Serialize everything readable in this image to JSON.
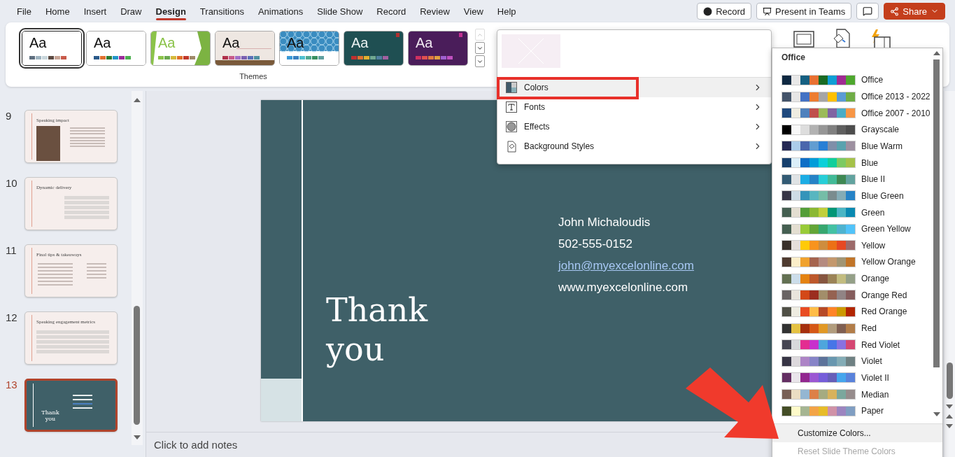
{
  "ribbon_tabs": [
    {
      "label": "File",
      "selected": false
    },
    {
      "label": "Home",
      "selected": false
    },
    {
      "label": "Insert",
      "selected": false
    },
    {
      "label": "Draw",
      "selected": false
    },
    {
      "label": "Design",
      "selected": true
    },
    {
      "label": "Transitions",
      "selected": false
    },
    {
      "label": "Animations",
      "selected": false
    },
    {
      "label": "Slide Show",
      "selected": false
    },
    {
      "label": "Record",
      "selected": false
    },
    {
      "label": "Review",
      "selected": false
    },
    {
      "label": "View",
      "selected": false
    },
    {
      "label": "Help",
      "selected": false
    }
  ],
  "title_actions": {
    "record": "Record",
    "present": "Present in Teams",
    "share": "Share"
  },
  "themes": {
    "label": "Themes",
    "items": [
      {
        "kind": "plain",
        "sample": "Aa",
        "selected": true,
        "colors": [
          {
            "color": "#5f6f7f"
          },
          {
            "color": "#9fb4c0"
          },
          {
            "color": "#c9d7dc"
          },
          {
            "color": "#5b4a42"
          },
          {
            "color": "#c7a496"
          },
          {
            "color": "#c85a4a"
          }
        ]
      },
      {
        "kind": "plain",
        "sample": "Aa",
        "selected": false,
        "colors": [
          {
            "color": "#2a5a8a"
          },
          {
            "color": "#e07030"
          },
          {
            "color": "#2e7d32"
          },
          {
            "color": "#2196c8"
          },
          {
            "color": "#9c2c9a"
          },
          {
            "color": "#4caf50"
          }
        ]
      },
      {
        "kind": "facet",
        "sample": "Aa",
        "selected": false,
        "colors": [
          {
            "color": "#8bc34a"
          },
          {
            "color": "#6aa84f"
          },
          {
            "color": "#d4b93c"
          },
          {
            "color": "#e0702a"
          },
          {
            "color": "#c0392b"
          },
          {
            "color": "#a08a6a"
          }
        ]
      },
      {
        "kind": "paper",
        "sample": "Aa",
        "selected": false,
        "colors": [
          {
            "color": "#b0304a"
          },
          {
            "color": "#c85a8a"
          },
          {
            "color": "#a070c8"
          },
          {
            "color": "#7a60b0"
          },
          {
            "color": "#5a70b8"
          },
          {
            "color": "#5090a0"
          }
        ]
      },
      {
        "kind": "pattern",
        "sample": "Aa",
        "selected": false,
        "colors": [
          {
            "color": "#3a9ad8"
          },
          {
            "color": "#3a80c0"
          },
          {
            "color": "#50c0d0"
          },
          {
            "color": "#50a890"
          },
          {
            "color": "#3a9060"
          },
          {
            "color": "#60a0a0"
          }
        ]
      },
      {
        "kind": "teal",
        "sample": "Aa",
        "selected": false,
        "colors": [
          {
            "color": "#c03030"
          },
          {
            "color": "#e07030"
          },
          {
            "color": "#e0b030"
          },
          {
            "color": "#70a890"
          },
          {
            "color": "#5080a0"
          },
          {
            "color": "#a060a0"
          }
        ]
      },
      {
        "kind": "purple",
        "sample": "Aa",
        "selected": false,
        "colors": [
          {
            "color": "#d03060"
          },
          {
            "color": "#e05050"
          },
          {
            "color": "#e07a40"
          },
          {
            "color": "#e0a040"
          },
          {
            "color": "#a060d0"
          },
          {
            "color": "#c050c0"
          }
        ]
      }
    ]
  },
  "variants_menu": {
    "items": [
      {
        "kind": "colors",
        "label": "Colors",
        "selected": true
      },
      {
        "kind": "fonts",
        "label": "Fonts",
        "selected": false
      },
      {
        "kind": "effects",
        "label": "Effects",
        "selected": false
      },
      {
        "kind": "background",
        "label": "Background Styles",
        "selected": false
      }
    ]
  },
  "colors_menu": {
    "heading": "Office",
    "palettes": [
      {
        "name": "Office",
        "colors": [
          {
            "color": "#0e2841"
          },
          {
            "color": "#e8e8e8"
          },
          {
            "color": "#156082"
          },
          {
            "color": "#e97132"
          },
          {
            "color": "#196b24"
          },
          {
            "color": "#0f9ed5"
          },
          {
            "color": "#a02b93"
          },
          {
            "color": "#4ea72e"
          }
        ]
      },
      {
        "name": "Office 2013 - 2022",
        "colors": [
          {
            "color": "#44546a"
          },
          {
            "color": "#e7e6e6"
          },
          {
            "color": "#4472c4"
          },
          {
            "color": "#ed7d31"
          },
          {
            "color": "#a5a5a5"
          },
          {
            "color": "#ffc000"
          },
          {
            "color": "#5b9bd5"
          },
          {
            "color": "#70ad47"
          }
        ]
      },
      {
        "name": "Office 2007 - 2010",
        "colors": [
          {
            "color": "#1f497d"
          },
          {
            "color": "#eeece1"
          },
          {
            "color": "#4f81bd"
          },
          {
            "color": "#c0504d"
          },
          {
            "color": "#9bbb59"
          },
          {
            "color": "#8064a2"
          },
          {
            "color": "#4bacc6"
          },
          {
            "color": "#f79646"
          }
        ]
      },
      {
        "name": "Grayscale",
        "colors": [
          {
            "color": "#000000"
          },
          {
            "color": "#f8f8f8"
          },
          {
            "color": "#dddddd"
          },
          {
            "color": "#b2b2b2"
          },
          {
            "color": "#969696"
          },
          {
            "color": "#808080"
          },
          {
            "color": "#5f5f5f"
          },
          {
            "color": "#4d4d4d"
          }
        ]
      },
      {
        "name": "Blue Warm",
        "colors": [
          {
            "color": "#242852"
          },
          {
            "color": "#acccea"
          },
          {
            "color": "#4a66ac"
          },
          {
            "color": "#629dd1"
          },
          {
            "color": "#297fd5"
          },
          {
            "color": "#7f8fa9"
          },
          {
            "color": "#5aa2ae"
          },
          {
            "color": "#9d90a0"
          }
        ]
      },
      {
        "name": "Blue",
        "colors": [
          {
            "color": "#17406d"
          },
          {
            "color": "#dbeff9"
          },
          {
            "color": "#0f6fc6"
          },
          {
            "color": "#009dd9"
          },
          {
            "color": "#0bd0d9"
          },
          {
            "color": "#10cf9b"
          },
          {
            "color": "#7cca62"
          },
          {
            "color": "#a5c249"
          }
        ]
      },
      {
        "name": "Blue II",
        "colors": [
          {
            "color": "#335b74"
          },
          {
            "color": "#dfe3e5"
          },
          {
            "color": "#1cade4"
          },
          {
            "color": "#2683c6"
          },
          {
            "color": "#27ced7"
          },
          {
            "color": "#42ba97"
          },
          {
            "color": "#3e8853"
          },
          {
            "color": "#62a39f"
          }
        ]
      },
      {
        "name": "Blue Green",
        "colors": [
          {
            "color": "#373545"
          },
          {
            "color": "#cedbe6"
          },
          {
            "color": "#3494ba"
          },
          {
            "color": "#58b6c0"
          },
          {
            "color": "#75bda7"
          },
          {
            "color": "#7a8c8e"
          },
          {
            "color": "#84acb6"
          },
          {
            "color": "#2683c6"
          }
        ]
      },
      {
        "name": "Green",
        "colors": [
          {
            "color": "#455f51"
          },
          {
            "color": "#e3ded1"
          },
          {
            "color": "#549e39"
          },
          {
            "color": "#8ab833"
          },
          {
            "color": "#c0cf3a"
          },
          {
            "color": "#029676"
          },
          {
            "color": "#4ab5c4"
          },
          {
            "color": "#0989b1"
          }
        ]
      },
      {
        "name": "Green Yellow",
        "colors": [
          {
            "color": "#455f51"
          },
          {
            "color": "#e3ded1"
          },
          {
            "color": "#99cb38"
          },
          {
            "color": "#63a537"
          },
          {
            "color": "#37a76f"
          },
          {
            "color": "#44c1a3"
          },
          {
            "color": "#4eb3cf"
          },
          {
            "color": "#51c3f9"
          }
        ]
      },
      {
        "name": "Yellow",
        "colors": [
          {
            "color": "#39302a"
          },
          {
            "color": "#e5dedb"
          },
          {
            "color": "#ffca08"
          },
          {
            "color": "#f8931d"
          },
          {
            "color": "#ce8d3e"
          },
          {
            "color": "#ec7016"
          },
          {
            "color": "#e64823"
          },
          {
            "color": "#9c6a6a"
          }
        ]
      },
      {
        "name": "Yellow Orange",
        "colors": [
          {
            "color": "#4e3b30"
          },
          {
            "color": "#fbeec9"
          },
          {
            "color": "#f0a22e"
          },
          {
            "color": "#a5644e"
          },
          {
            "color": "#b58b80"
          },
          {
            "color": "#c3986d"
          },
          {
            "color": "#a19574"
          },
          {
            "color": "#c17529"
          }
        ]
      },
      {
        "name": "Orange",
        "colors": [
          {
            "color": "#637052"
          },
          {
            "color": "#ccddea"
          },
          {
            "color": "#e48312"
          },
          {
            "color": "#bd582c"
          },
          {
            "color": "#865640"
          },
          {
            "color": "#9b8357"
          },
          {
            "color": "#c2bc80"
          },
          {
            "color": "#94a088"
          }
        ]
      },
      {
        "name": "Orange Red",
        "colors": [
          {
            "color": "#696464"
          },
          {
            "color": "#e9e5dc"
          },
          {
            "color": "#d34817"
          },
          {
            "color": "#9b2d1f"
          },
          {
            "color": "#a28e6a"
          },
          {
            "color": "#956251"
          },
          {
            "color": "#918485"
          },
          {
            "color": "#855d5d"
          }
        ]
      },
      {
        "name": "Red Orange",
        "colors": [
          {
            "color": "#505046"
          },
          {
            "color": "#eeece1"
          },
          {
            "color": "#e84c22"
          },
          {
            "color": "#ffbd47"
          },
          {
            "color": "#b64926"
          },
          {
            "color": "#ff8427"
          },
          {
            "color": "#cc9900"
          },
          {
            "color": "#b22600"
          }
        ]
      },
      {
        "name": "Red",
        "colors": [
          {
            "color": "#323232"
          },
          {
            "color": "#e5c243"
          },
          {
            "color": "#a5300f"
          },
          {
            "color": "#d55816"
          },
          {
            "color": "#e19825"
          },
          {
            "color": "#b19c7d"
          },
          {
            "color": "#7f5f52"
          },
          {
            "color": "#b27d49"
          }
        ]
      },
      {
        "name": "Red Violet",
        "colors": [
          {
            "color": "#454551"
          },
          {
            "color": "#d8d9dc"
          },
          {
            "color": "#e32d91"
          },
          {
            "color": "#c830cc"
          },
          {
            "color": "#4ea6dc"
          },
          {
            "color": "#4775e7"
          },
          {
            "color": "#8971e1"
          },
          {
            "color": "#d54773"
          }
        ]
      },
      {
        "name": "Violet",
        "colors": [
          {
            "color": "#373545"
          },
          {
            "color": "#dcd8dc"
          },
          {
            "color": "#ad84c6"
          },
          {
            "color": "#8784c7"
          },
          {
            "color": "#5d739a"
          },
          {
            "color": "#6997af"
          },
          {
            "color": "#84acb6"
          },
          {
            "color": "#6f8183"
          }
        ]
      },
      {
        "name": "Violet II",
        "colors": [
          {
            "color": "#632e62"
          },
          {
            "color": "#eae5eb"
          },
          {
            "color": "#92278f"
          },
          {
            "color": "#9b57d3"
          },
          {
            "color": "#755dd9"
          },
          {
            "color": "#665eb8"
          },
          {
            "color": "#45a5ed"
          },
          {
            "color": "#5982db"
          }
        ]
      },
      {
        "name": "Median",
        "colors": [
          {
            "color": "#775f55"
          },
          {
            "color": "#ebddc3"
          },
          {
            "color": "#94b6d2"
          },
          {
            "color": "#dd8047"
          },
          {
            "color": "#a5ab81"
          },
          {
            "color": "#d8b25c"
          },
          {
            "color": "#7ba79d"
          },
          {
            "color": "#968c8c"
          }
        ]
      },
      {
        "name": "Paper",
        "colors": [
          {
            "color": "#444d26"
          },
          {
            "color": "#fefac9"
          },
          {
            "color": "#a5b592"
          },
          {
            "color": "#f3a447"
          },
          {
            "color": "#e7bc29"
          },
          {
            "color": "#d092a7"
          },
          {
            "color": "#9c85c0"
          },
          {
            "color": "#809ec2"
          }
        ]
      }
    ],
    "actions": [
      {
        "label": "Customize Colors...",
        "selected": true,
        "disabled": false
      },
      {
        "label": "Reset Slide Theme Colors",
        "selected": false,
        "disabled": true
      }
    ]
  },
  "slide_pane": {
    "slides": [
      {
        "number": "9",
        "kind": "photo",
        "title": "Speaking impact",
        "selected": false
      },
      {
        "number": "10",
        "kind": "table",
        "title": "Dynamic delivery",
        "selected": false
      },
      {
        "number": "11",
        "kind": "bullets",
        "title": "Final tips & takeaways",
        "selected": false
      },
      {
        "number": "12",
        "kind": "table",
        "title": "Speaking engagement metrics",
        "selected": false
      },
      {
        "number": "13",
        "kind": "closing",
        "title": "Thank you",
        "selected": true
      }
    ]
  },
  "slide": {
    "title": "Thank you",
    "contact": [
      {
        "kind": "text",
        "text": "John Michaloudis"
      },
      {
        "kind": "text",
        "text": "502-555-0152"
      },
      {
        "kind": "link",
        "text": "john@myexcelonline.com"
      },
      {
        "kind": "text",
        "text": "www.myexcelonline.com"
      }
    ]
  },
  "notes": {
    "placeholder": "Click to add notes"
  }
}
